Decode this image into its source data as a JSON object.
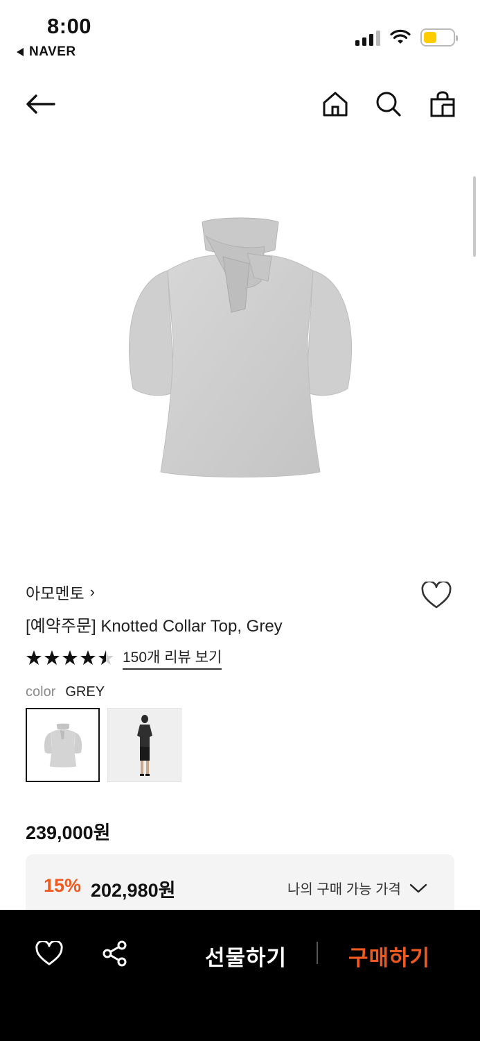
{
  "status_bar": {
    "time": "8:00",
    "back_app": "NAVER",
    "icons": [
      "signal-icon",
      "wifi-icon",
      "battery-icon"
    ]
  },
  "nav": {
    "icons": [
      "back-arrow-icon",
      "home-icon",
      "search-icon",
      "shopping-bag-icon"
    ]
  },
  "product": {
    "brand": "아모멘토",
    "title": "[예약주문] Knotted Collar Top, Grey",
    "rating": 4.5,
    "review_link": "150개 리뷰 보기",
    "color_label": "color",
    "color_value": "GREY",
    "price": "239,000원"
  },
  "discount": {
    "percent": "15%",
    "price": "202,980원",
    "my_price_label": "나의 구매 가능 가격"
  },
  "bottom_bar": {
    "gift_label": "선물하기",
    "buy_label": "구매하기"
  },
  "colors": {
    "accent": "#f05a1e",
    "battery": "#ffcc00",
    "bottom_bar_bg": "#000000"
  }
}
